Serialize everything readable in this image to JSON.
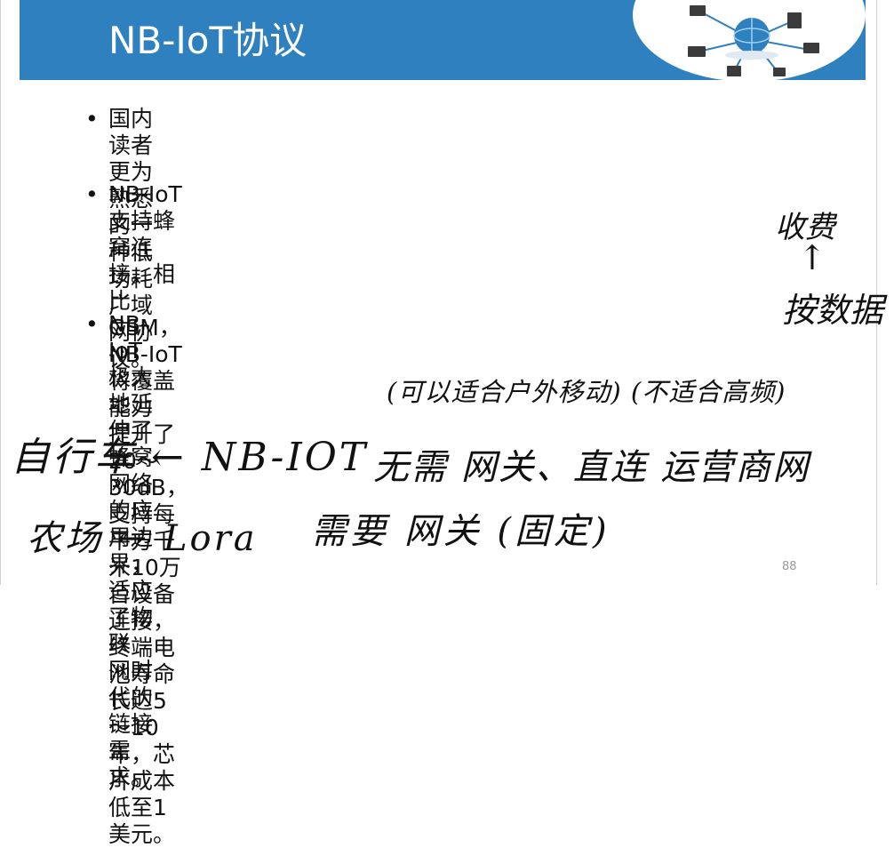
{
  "slide": {
    "title": "NB-IoT协议",
    "bullets": [
      {
        "text": "国内读者更为熟悉的一种低功耗广域网协议。"
      },
      {
        "text": "NB-IoT支持蜂窝连接。相比GSM，NB-IoT将覆盖能力\n提升了20～30dB，支持每平方千米10万台设备连接，\n终端电池寿命长达5～10年，芯片成本低至1美元。"
      },
      {
        "text": "NB-IoT极大地延伸了蜂窝网络的应用边界，适应了物联\n网时代的链接需求。"
      }
    ],
    "bullet_symbol": "•",
    "page_number": "88",
    "accent_color": "#2f80bf"
  },
  "annotations": {
    "line1": "(可以适合户外移动) (不适合高频)",
    "line2": "自行车 ← NB-IOT",
    "line3": "无需 网关、直连 运营商网",
    "line4": "农场 ← Lora",
    "line5": "需要 网关 (固定)",
    "margin1": "收费",
    "margin2": "↑",
    "margin3": "按数据"
  },
  "icons": {
    "header_graphic": "network-globe-icon"
  }
}
